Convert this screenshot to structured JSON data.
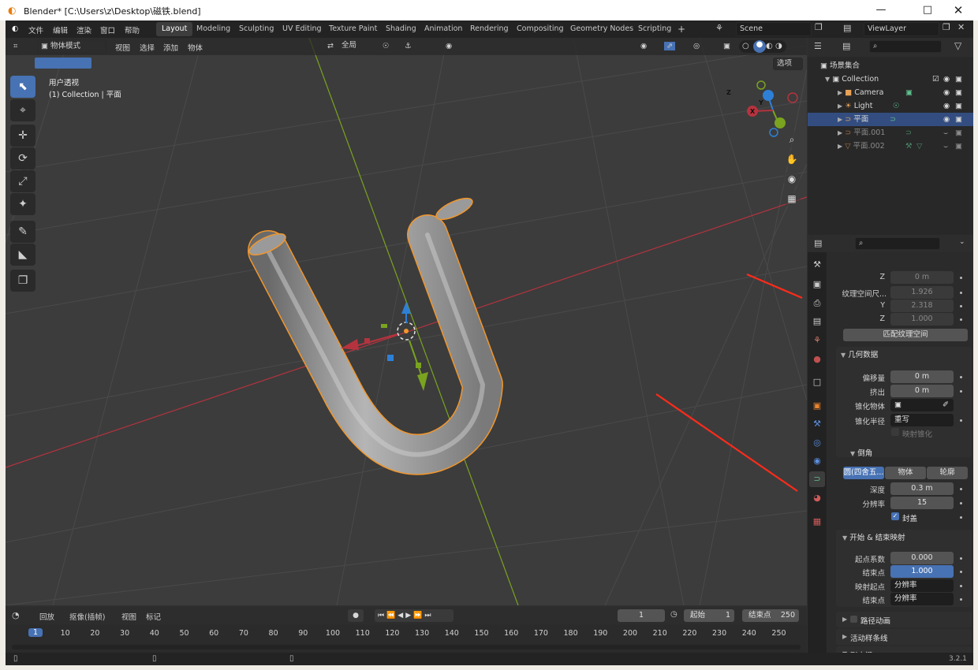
{
  "window": {
    "title": "Blender* [C:\\Users\\z\\Desktop\\磁铁.blend]"
  },
  "topbar": {
    "menus": [
      "文件",
      "编辑",
      "渲染",
      "窗口",
      "帮助"
    ],
    "workspaces": [
      "Layout",
      "Modeling",
      "Sculpting",
      "UV Editing",
      "Texture Paint",
      "Shading",
      "Animation",
      "Rendering",
      "Compositing",
      "Geometry Nodes",
      "Scripting"
    ],
    "active_workspace": "Layout",
    "add_tab": "+",
    "scene": "Scene",
    "viewlayer": "ViewLayer"
  },
  "viewport_header": {
    "mode": "物体模式",
    "menus": [
      "视图",
      "选择",
      "添加",
      "物体"
    ],
    "transform_orientation": "全局",
    "options_label": "选项"
  },
  "viewport_overlay": {
    "view_name": "用户透视",
    "collection_info": "(1) Collection | 平面"
  },
  "gizmo": {
    "x": "X",
    "y": "Y",
    "z": "Z"
  },
  "outliner": {
    "root": "场景集合",
    "items": [
      {
        "label": "Collection",
        "level": 1
      },
      {
        "label": "Camera",
        "level": 2
      },
      {
        "label": "Light",
        "level": 2
      },
      {
        "label": "平面",
        "level": 2,
        "selected": true
      },
      {
        "label": "平面.001",
        "level": 2,
        "hidden": true
      },
      {
        "label": "平面.002",
        "level": 2,
        "hidden": true
      }
    ]
  },
  "properties": {
    "texspace": {
      "z_label": "Z",
      "z_value": "0 m",
      "size_label": "纹理空间尺...",
      "size_x": "1.926",
      "y_label": "Y",
      "y_value": "2.318",
      "z2_label": "Z",
      "z2_value": "1.000",
      "match_button": "匹配纹理空间"
    },
    "geometry": {
      "header": "几何数据",
      "offset_label": "偏移量",
      "offset_value": "0 m",
      "extrude_label": "挤出",
      "extrude_value": "0 m",
      "taper_object_label": "锥化物体",
      "taper_radius_label": "锥化半径",
      "taper_radius_value": "重写",
      "map_taper_label": "映射锥化"
    },
    "bevel": {
      "header": "倒角",
      "modes": [
        "圆(四舍五...",
        "物体",
        "轮廓"
      ],
      "depth_label": "深度",
      "depth_value": "0.3 m",
      "resolution_label": "分辨率",
      "resolution_value": "15",
      "fill_caps_label": "封盖"
    },
    "start_end": {
      "header": "开始 & 结束映射",
      "start_label": "起点系数",
      "start_value": "0.000",
      "end_label": "结束点",
      "end_value": "1.000",
      "map_start_label": "映射起点",
      "map_start_value": "分辨率",
      "map_end_label": "结束点",
      "map_end_value": "分辨率"
    },
    "path_anim": "路径动画",
    "active_spline": "活动样条线",
    "shape_keys": "形态键"
  },
  "timeline": {
    "menus": [
      "回放",
      "抠像(插帧)",
      "视图",
      "标记"
    ],
    "current_frame": "1",
    "start_label": "起始",
    "start_value": "1",
    "end_label": "结束点",
    "end_value": "250",
    "ticks": [
      "1",
      "10",
      "20",
      "30",
      "40",
      "50",
      "60",
      "70",
      "80",
      "90",
      "100",
      "110",
      "120",
      "130",
      "140",
      "150",
      "160",
      "170",
      "180",
      "190",
      "200",
      "210",
      "220",
      "230",
      "240",
      "250"
    ]
  },
  "statusbar": {
    "version": "3.2.1"
  },
  "colors": {
    "accent": "#4772b3",
    "selection_outline": "#f0962d",
    "x_axis": "#b5333e",
    "y_axis": "#7aa31f",
    "z_axis": "#2e80d6",
    "annotation_arrow": "#ff2b1a"
  }
}
